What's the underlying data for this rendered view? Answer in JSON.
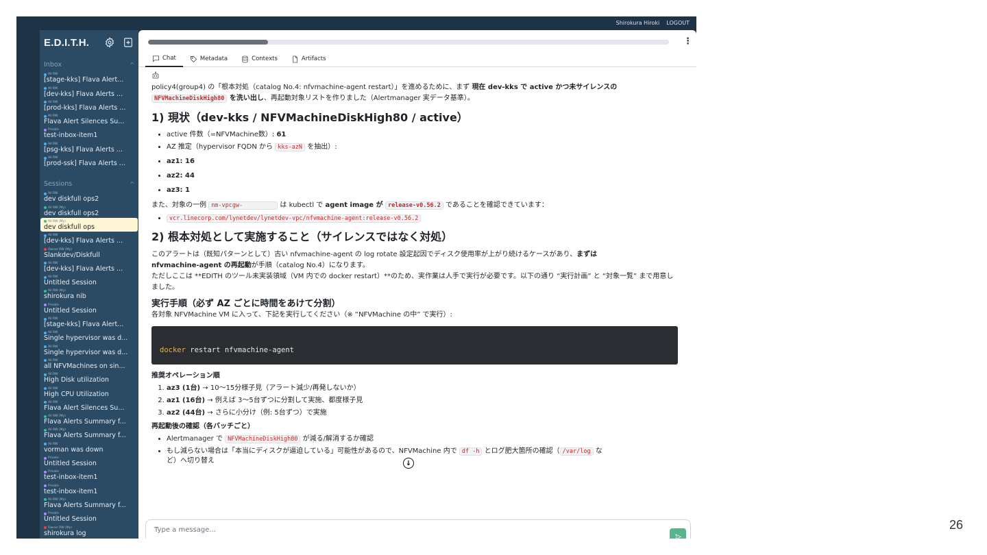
{
  "topbar": {
    "user": "Shirokura Hiroki",
    "logout": "LOGOUT"
  },
  "sidebar": {
    "brand": "E.D.I.T.H.",
    "icons": [
      "gear-icon",
      "export-icon"
    ],
    "inbox_title": "Inbox",
    "sessions_title": "Sessions",
    "inbox": [
      {
        "tag": "All RW",
        "label": "[stage-kks] Flava Alert...",
        "dot": "#4fb0e8"
      },
      {
        "tag": "All RW",
        "label": "[dev-kks] Flava Alerts ...",
        "dot": "#4fb0e8"
      },
      {
        "tag": "All RW",
        "label": "[prod-kks] Flava Alerts ...",
        "dot": "#4fb0e8"
      },
      {
        "tag": "All RW",
        "label": "Flava Alert Silences Su...",
        "dot": "#4fb0e8"
      },
      {
        "tag": "Private",
        "label": "test-inbox-item1",
        "dot": "#a78bfa"
      },
      {
        "tag": "All RW",
        "label": "[psg-kks] Flava Alerts ...",
        "dot": "#4fb0e8"
      },
      {
        "tag": "All RW",
        "label": "[prod-ssk] Flava Alerts ...",
        "dot": "#4fb0e8"
      }
    ],
    "sessions": [
      {
        "tag": "All RW",
        "label": "dev diskfull ops2",
        "dot": "#4fb0e8"
      },
      {
        "tag": "All RW (My)",
        "label": "dev diskfull ops2",
        "dot": "#34c38f"
      },
      {
        "tag": "All RW (My)",
        "label": "dev diskfull ops",
        "dot": "#34c38f",
        "active": true
      },
      {
        "tag": "All RW",
        "label": "[dev-kks] Flava Alerts ...",
        "dot": "#4fb0e8"
      },
      {
        "tag": "Owner RW (My)",
        "label": "Slankdev/Diskfull",
        "dot": "#ef4444"
      },
      {
        "tag": "All RW",
        "label": "[dev-kks] Flava Alerts ...",
        "dot": "#4fb0e8"
      },
      {
        "tag": "All RW",
        "label": "Untitled Session",
        "dot": "#4fb0e8"
      },
      {
        "tag": "All RW (My)",
        "label": "shirokura nib",
        "dot": "#34c38f"
      },
      {
        "tag": "Private",
        "label": "Untitled Session",
        "dot": "#a78bfa"
      },
      {
        "tag": "All RW",
        "label": "[stage-kks] Flava Alert...",
        "dot": "#4fb0e8"
      },
      {
        "tag": "All RW",
        "label": "Single hypervisor was d...",
        "dot": "#4fb0e8"
      },
      {
        "tag": "All RW",
        "label": "Single hypervisor was d...",
        "dot": "#4fb0e8"
      },
      {
        "tag": "All RW",
        "label": "all NFVMachines on sin...",
        "dot": "#4fb0e8"
      },
      {
        "tag": "All RW",
        "label": "High Disk utilization",
        "dot": "#4fb0e8"
      },
      {
        "tag": "All RW",
        "label": "High CPU Utilization",
        "dot": "#4fb0e8"
      },
      {
        "tag": "All RW",
        "label": "Flava Alert Silences Su...",
        "dot": "#4fb0e8"
      },
      {
        "tag": "All RW (My)",
        "label": "Flava Alerts Summary f...",
        "dot": "#34c38f"
      },
      {
        "tag": "All RW (My)",
        "label": "Flava Alerts Summary f...",
        "dot": "#34c38f"
      },
      {
        "tag": "All RW",
        "label": "vorman was down",
        "dot": "#4fb0e8"
      },
      {
        "tag": "Private",
        "label": "Untitled Session",
        "dot": "#a78bfa"
      },
      {
        "tag": "Private",
        "label": "test-inbox-item1",
        "dot": "#a78bfa"
      },
      {
        "tag": "Private",
        "label": "test-inbox-item1",
        "dot": "#a78bfa"
      },
      {
        "tag": "All RW (My)",
        "label": "Flava Alerts Summary f...",
        "dot": "#34c38f"
      },
      {
        "tag": "Private",
        "label": "Untitled Session",
        "dot": "#a78bfa"
      },
      {
        "tag": "Owner RW (My)",
        "label": "shirokura log",
        "dot": "#ef4444"
      }
    ]
  },
  "main": {
    "progress": 0.23,
    "tabs": [
      {
        "label": "Chat",
        "icon": "chat-icon",
        "active": true
      },
      {
        "label": "Metadata",
        "icon": "tag-icon"
      },
      {
        "label": "Contexts",
        "icon": "database-icon"
      },
      {
        "label": "Artifacts",
        "icon": "file-icon"
      }
    ]
  },
  "message": {
    "intro_1": "policy4(group4) の「根本対処（catalog No.4: nfvmachine-agent restart）」を進めるために、まず ",
    "intro_bold": "現在 dev-kks で active かつ未サイレンスの",
    "intro_code": "NFVMachineDiskHigh80",
    "intro_bold2": " を洗い出し",
    "intro_2": "、再起動対象リストを作りました（Alertmanager 実データ基準）。",
    "h1": "1) 現状（dev-kks / NFVMachineDiskHigh80 / active）",
    "active_count_label": "active 件数（=NFVMachine数）: ",
    "active_count_value": "61",
    "az_label_1": "AZ 推定（hypervisor FQDN から ",
    "az_code": "kks-azN",
    "az_label_2": " を抽出）:",
    "az1": "az1: 16",
    "az2": "az2: 44",
    "az3": "az3: 1",
    "example_1": "また、対象の一例 ",
    "example_code": "nm-vpcgw-",
    "example_2": " は kubectl で ",
    "example_bold": "agent image が ",
    "example_code2": "release-v0.56.2",
    "example_3": " であることを確認できています：",
    "image_code": "vcr.linecorp.com/lynetdev/lynetdev-vpc/nfvmachine-agent:release-v0.56.2",
    "h2": "2) 根本対処として実施すること（サイレンスではなく対処）",
    "p2_1": "このアラートは（既知パターンとして）古い nfvmachine-agent の log rotate 設定起因でディスク使用率が上がり続けるケースがあり、",
    "p2_bold1": "まずは",
    "p2_bold2": "nfvmachine-agent の再起動",
    "p2_2": "が手順（catalog No.4）になります。",
    "p3": "ただしここは **EDITH のツール未実装領域（VM 内での docker restart）**のため、実作業は人手で実行が必要です。以下の通り “実行計画” と “対象一覧” まで用意しました。",
    "h3": "実行手順（必ず AZ ごとに時間をあけて分割）",
    "p4": "各対象 NFVMachine VM に入って、下記を実行してください（※ “NFVMachine の中” で実行）:",
    "cmd_kw": "docker",
    "cmd_rest": " restart nfvmachine-agent",
    "h4a": "推奨オペレーション順",
    "ops": [
      {
        "bold": "az3 (1台)",
        "text": " → 10〜15分様子見（アラート減少/再発しないか）"
      },
      {
        "bold": "az1 (16台)",
        "text": " → 例えば 3〜5台ずつに分割して実施、都度様子見"
      },
      {
        "bold": "az2 (44台)",
        "text": " → さらに小分け（例: 5台ずつ）で実施"
      }
    ],
    "h4b": "再起動後の確認（各バッチごと）",
    "check1_1": "Alertmanager で ",
    "check1_code": "NFVMachineDiskHigh80",
    "check1_2": " が減る/解消するか確認",
    "check2_1": "もし減らない場合は「本当にディスクが逼迫している」可能性があるので、NFVMachine 内で ",
    "check2_code": "df -h",
    "check2_2": " とログ肥大箇所の確認（",
    "check2_code2": "/var/log",
    "check2_3": " な",
    "check2_4": "ど）へ切り替え"
  },
  "composer": {
    "placeholder": "Type a message..."
  },
  "page_number": "26"
}
